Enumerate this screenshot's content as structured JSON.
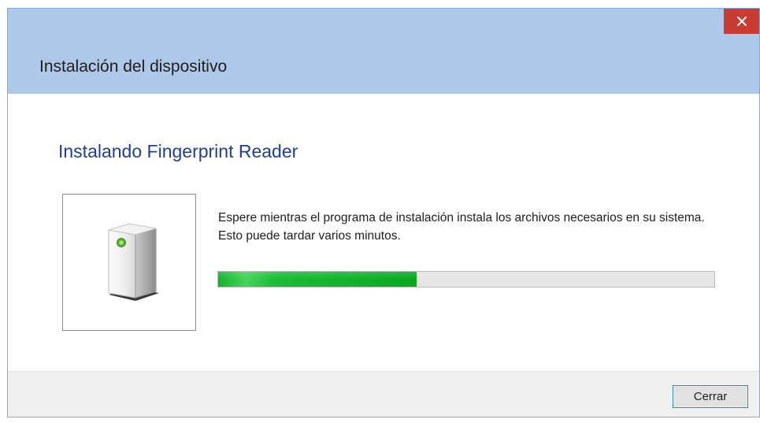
{
  "window": {
    "title": "Instalación del dispositivo",
    "close_icon": "close-icon"
  },
  "content": {
    "heading": "Instalando Fingerprint Reader",
    "device_icon": "device-tower-icon",
    "message": "Espere mientras el programa de instalación instala los archivos necesarios en su sistema. Esto puede tardar varios minutos.",
    "progress_fraction": 0.4
  },
  "footer": {
    "close_button_label": "Cerrar"
  },
  "colors": {
    "titlebar": "#adc8e8",
    "close_button": "#c83c31",
    "heading": "#1e3f97",
    "progress_fill": "#06b025"
  }
}
